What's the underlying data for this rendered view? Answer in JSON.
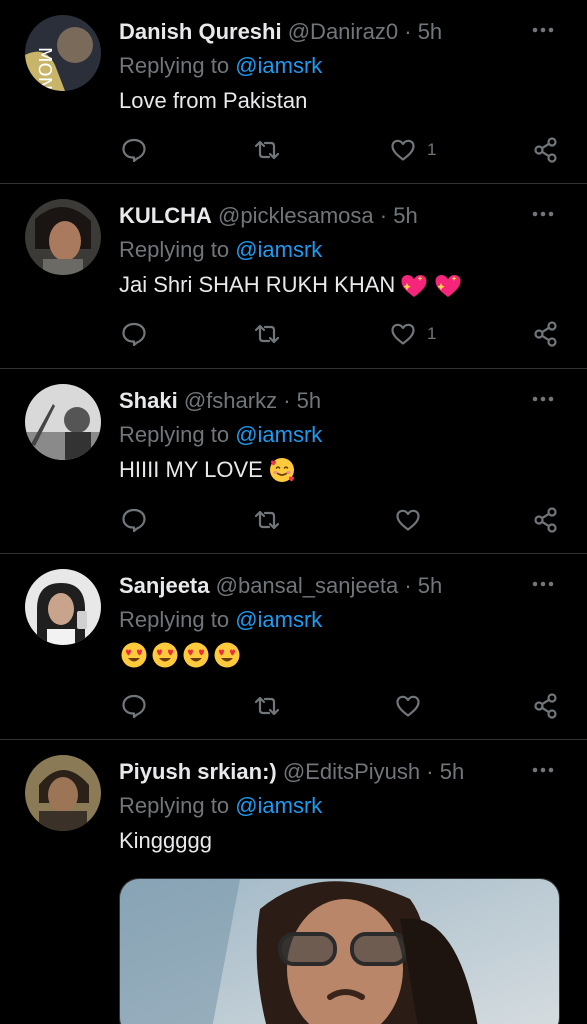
{
  "replies": [
    {
      "name": "Danish Qureshi",
      "handle": "@Daniraz0",
      "time": "5h",
      "replying_label": "Replying to ",
      "replying_to": "@iamsrk",
      "text": "Love from Pakistan",
      "likes": "1",
      "avatar_icon": "avatar-photo"
    },
    {
      "name": "KULCHA",
      "handle": "@picklesamosa",
      "time": "5h",
      "replying_label": "Replying to ",
      "replying_to": "@iamsrk",
      "text": "Jai Shri SHAH RUKH KHAN",
      "emojis": [
        "sparkling-heart-icon",
        "sparkling-heart-icon"
      ],
      "likes": "1",
      "avatar_icon": "avatar-photo"
    },
    {
      "name": "Shaki",
      "handle": "@fsharkz",
      "time": "5h",
      "replying_label": "Replying to ",
      "replying_to": "@iamsrk",
      "text": "HIIII MY LOVE",
      "emojis": [
        "smiling-face-with-hearts-icon"
      ],
      "likes": "",
      "avatar_icon": "avatar-photo"
    },
    {
      "name": "Sanjeeta",
      "handle": "@bansal_sanjeeta",
      "time": "5h",
      "replying_label": "Replying to ",
      "replying_to": "@iamsrk",
      "text": "",
      "emojis": [
        "heart-eyes-icon",
        "heart-eyes-icon",
        "heart-eyes-icon",
        "heart-eyes-icon"
      ],
      "likes": "",
      "avatar_icon": "avatar-photo"
    },
    {
      "name": "Piyush srkian:)",
      "handle": "@EditsPiyush",
      "time": "5h",
      "replying_label": "Replying to ",
      "replying_to": "@iamsrk",
      "text": "Kinggggg",
      "likes": "",
      "avatar_icon": "avatar-photo"
    }
  ],
  "separator": "·",
  "colors": {
    "background": "#000000",
    "text": "#e7e9ea",
    "muted": "#71767b",
    "link": "#1d9bf0",
    "divider": "#2f3336"
  }
}
